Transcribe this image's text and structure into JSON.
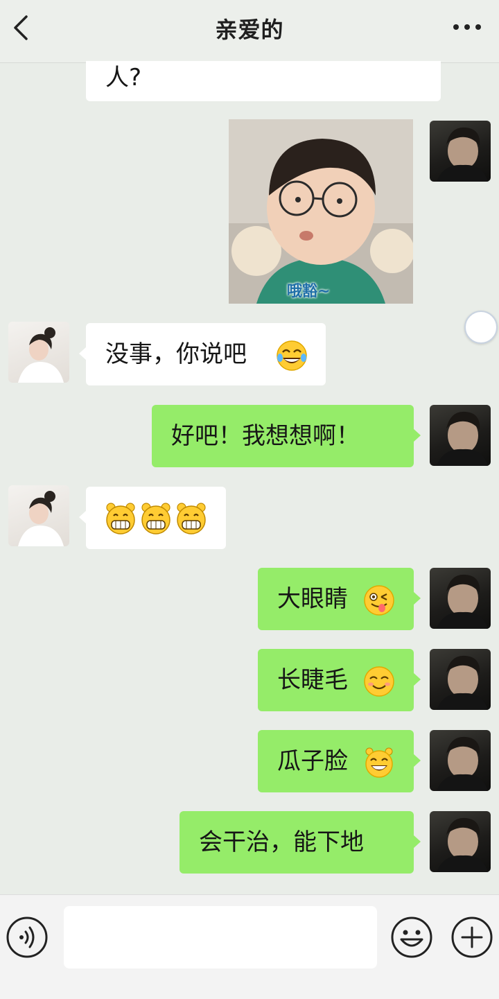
{
  "header": {
    "title": "亲爱的"
  },
  "messages": {
    "m0_tail": "人?",
    "m1_sticker_caption": "哦豁~",
    "m2_text": "没事，你说吧",
    "m3_text": "好吧！我想想啊！",
    "m5_text": "大眼睛",
    "m6_text": "长睫毛",
    "m7_text": "瓜子脸",
    "m8_text": "会干治，能下地"
  },
  "icons": {
    "back": "chevron-left-icon",
    "more": "more-dots-icon",
    "voice": "voice-icon",
    "emoji": "smiley-icon",
    "plus": "plus-icon"
  },
  "colors": {
    "outgoing_bubble": "#95ec69",
    "incoming_bubble": "#ffffff",
    "chat_background": "#e9ede8"
  }
}
